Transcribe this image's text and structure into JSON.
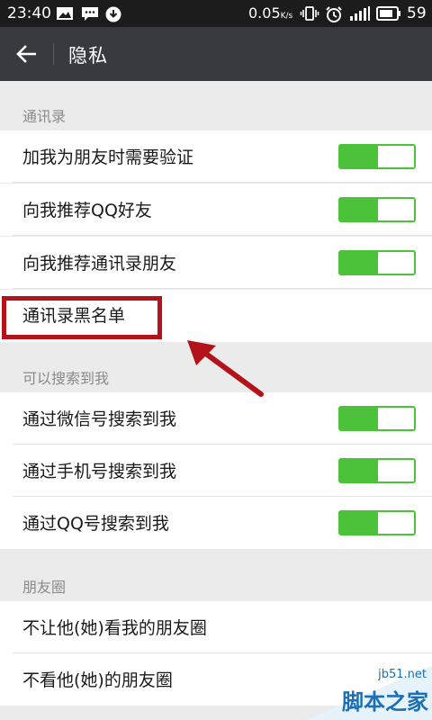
{
  "status_bar": {
    "time": "23:40",
    "net_speed": "0.05",
    "net_unit": "K/s",
    "battery": "59"
  },
  "app_bar": {
    "title": "隐私"
  },
  "sections": [
    {
      "header": "通讯录",
      "items": [
        {
          "label": "加我为朋友时需要验证",
          "toggle": true
        },
        {
          "label": "向我推荐QQ好友",
          "toggle": true
        },
        {
          "label": "向我推荐通讯录朋友",
          "toggle": true
        },
        {
          "label": "通讯录黑名单",
          "toggle": false
        }
      ]
    },
    {
      "header": "可以搜索到我",
      "items": [
        {
          "label": "通过微信号搜索到我",
          "toggle": true
        },
        {
          "label": "通过手机号搜索到我",
          "toggle": true
        },
        {
          "label": "通过QQ号搜索到我",
          "toggle": true
        }
      ]
    },
    {
      "header": "朋友圈",
      "items": [
        {
          "label": "不让他(她)看我的朋友圈"
        },
        {
          "label": "不看他(她)的朋友圈"
        }
      ]
    }
  ],
  "watermark": {
    "site": "jb51.net",
    "name": "脚本之家"
  },
  "colors": {
    "toggle_on": "#4cc13a",
    "app_bar": "#393a3f",
    "highlight": "#b3121b"
  }
}
